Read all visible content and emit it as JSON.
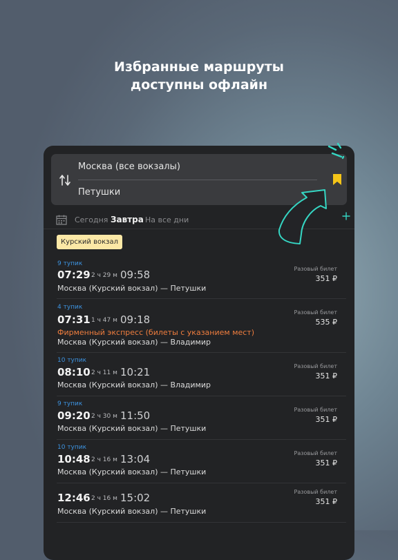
{
  "headline": {
    "line1": "Избранные маршруты",
    "line2": "доступны офлайн"
  },
  "route": {
    "from": "Москва (все вокзалы)",
    "to": "Петушки"
  },
  "dates": {
    "today": "Сегодня",
    "tomorrow": "Завтра",
    "all": "На все дни"
  },
  "station_chip": "Курский вокзал",
  "ticket_label": "Разовый билет",
  "trips": [
    {
      "track": "9 тупик",
      "dep": "07:29",
      "dur": "2 ч 29 м",
      "arr": "09:58",
      "note": "",
      "dir": "Москва (Курский вокзал) — Петушки",
      "price": "351 ₽"
    },
    {
      "track": "4 тупик",
      "dep": "07:31",
      "dur": "1 ч 47 м",
      "arr": "09:18",
      "note": "Фирменный экспресс (билеты с указанием мест)",
      "dir": "Москва (Курский вокзал) — Владимир",
      "price": "535 ₽"
    },
    {
      "track": "10 тупик",
      "dep": "08:10",
      "dur": "2 ч 11 м",
      "arr": "10:21",
      "note": "",
      "dir": "Москва (Курский вокзал) — Владимир",
      "price": "351 ₽"
    },
    {
      "track": "9 тупик",
      "dep": "09:20",
      "dur": "2 ч 30 м",
      "arr": "11:50",
      "note": "",
      "dir": "Москва (Курский вокзал) — Петушки",
      "price": "351 ₽"
    },
    {
      "track": "10 тупик",
      "dep": "10:48",
      "dur": "2 ч 16 м",
      "arr": "13:04",
      "note": "",
      "dir": "Москва (Курский вокзал) — Петушки",
      "price": "351 ₽"
    },
    {
      "track": "",
      "dep": "12:46",
      "dur": "2 ч 16 м",
      "arr": "15:02",
      "note": "",
      "dir": "Москва (Курский вокзал) — Петушки",
      "price": "351 ₽"
    }
  ],
  "colors": {
    "accent_yellow": "#f5c518",
    "track_blue": "#3d93e0",
    "note_orange": "#ee7d3e",
    "decor_teal": "#35d6c3"
  },
  "icons": {
    "swap": "swap-arrows-icon",
    "bookmark": "bookmark-icon",
    "calendar": "calendar-icon"
  }
}
